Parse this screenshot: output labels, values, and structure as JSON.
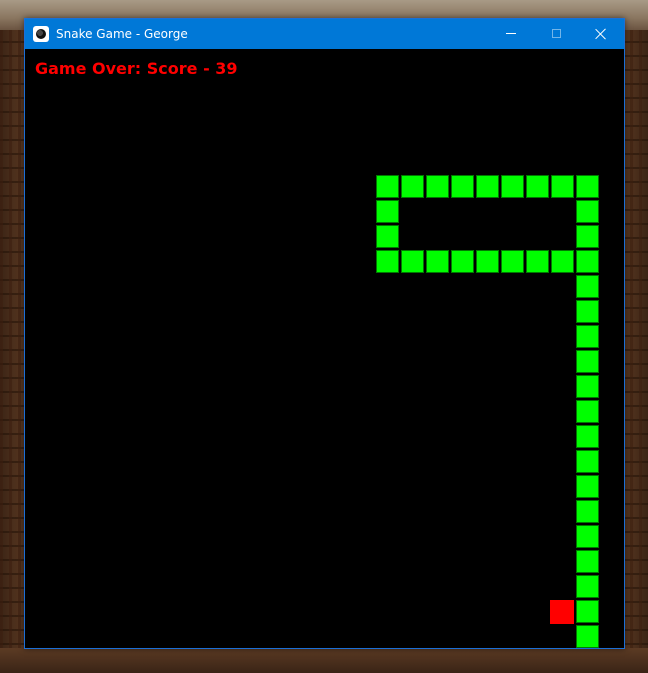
{
  "window": {
    "title": "Snake Game - George",
    "controls": {
      "minimize": "minimize",
      "maximize": "maximize",
      "close": "close"
    },
    "accent_color": "#0078d7"
  },
  "game": {
    "status_text": "Game Over: Score - 39",
    "status_color": "#ff0000",
    "background_color": "#000000",
    "snake_color": "#00ff00",
    "food_color": "#ff0000",
    "grid_cell_units": 25,
    "snake_cells": [
      [
        14,
        5
      ],
      [
        15,
        5
      ],
      [
        16,
        5
      ],
      [
        17,
        5
      ],
      [
        18,
        5
      ],
      [
        19,
        5
      ],
      [
        20,
        5
      ],
      [
        21,
        5
      ],
      [
        22,
        5
      ],
      [
        14,
        6
      ],
      [
        22,
        6
      ],
      [
        14,
        7
      ],
      [
        22,
        7
      ],
      [
        14,
        8
      ],
      [
        15,
        8
      ],
      [
        16,
        8
      ],
      [
        17,
        8
      ],
      [
        18,
        8
      ],
      [
        19,
        8
      ],
      [
        20,
        8
      ],
      [
        21,
        8
      ],
      [
        22,
        8
      ],
      [
        22,
        9
      ],
      [
        22,
        10
      ],
      [
        22,
        11
      ],
      [
        22,
        12
      ],
      [
        22,
        13
      ],
      [
        22,
        14
      ],
      [
        22,
        15
      ],
      [
        22,
        16
      ],
      [
        22,
        17
      ],
      [
        22,
        18
      ],
      [
        22,
        19
      ],
      [
        22,
        20
      ],
      [
        22,
        21
      ],
      [
        22,
        22
      ],
      [
        22,
        23
      ]
    ],
    "food_cell": [
      21,
      22
    ]
  },
  "icons": {
    "app": "snake-game-app-icon",
    "minimize": "minimize-icon",
    "maximize": "maximize-icon",
    "close": "close-icon"
  }
}
